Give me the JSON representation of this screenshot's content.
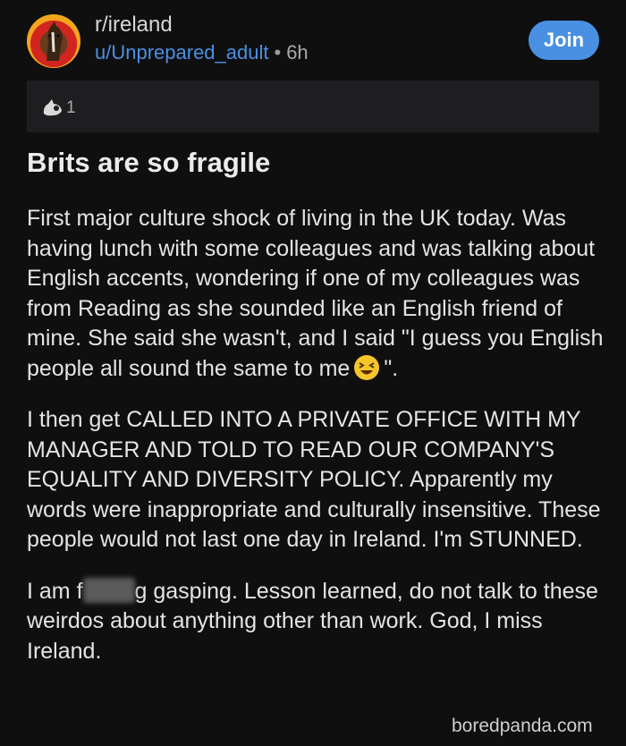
{
  "header": {
    "subreddit": "r/ireland",
    "username": "u/Unprepared_adult",
    "separator": "•",
    "time": "6h",
    "join_label": "Join"
  },
  "awards": {
    "count": "1"
  },
  "post": {
    "title": "Brits are so fragile",
    "p1_text": "First major culture shock of living in the UK today. Was having lunch with some colleagues and was talking about English accents, wondering if one of my colleagues was from Reading as she sounded like an English friend of mine. She said she wasn't, and I said \"I guess you English people all sound the same to me",
    "p1_end": "\".",
    "p2": "I then get CALLED INTO A PRIVATE OFFICE WITH MY MANAGER AND TOLD TO READ OUR COMPANY'S EQUALITY AND DIVERSITY POLICY. Apparently my words were inappropriate and culturally insensitive. These people would not last one day in Ireland. I'm STUNNED.",
    "p3_start": "I am f",
    "p3_rest": "g gasping. Lesson learned, do not talk to these weirdos about anything other than work. God, I miss Ireland."
  },
  "icons": {
    "avatar": "horse-logo",
    "award": "award-icon",
    "emoji": "laughing-squint-emoji"
  },
  "colors": {
    "background": "#0f0f10",
    "accent": "#4a90e2"
  },
  "watermark": "boredpanda.com"
}
